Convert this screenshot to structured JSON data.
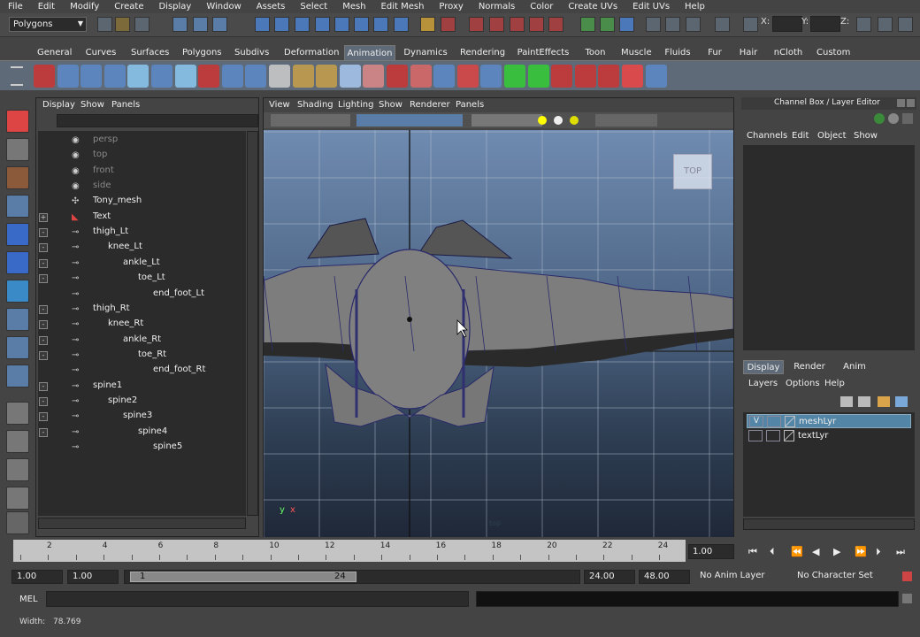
{
  "menubar": [
    "File",
    "Edit",
    "Modify",
    "Create",
    "Display",
    "Window",
    "Assets",
    "Select",
    "Mesh",
    "Edit Mesh",
    "Proxy",
    "Normals",
    "Color",
    "Create UVs",
    "Edit UVs",
    "Help"
  ],
  "statusline": {
    "mode": "Polygons",
    "x_label": "X:",
    "y_label": "Y:",
    "z_label": "Z:"
  },
  "shelf_tabs": [
    "General",
    "Curves",
    "Surfaces",
    "Polygons",
    "Subdivs",
    "Deformation",
    "Animation",
    "Dynamics",
    "Rendering",
    "PaintEffects",
    "Toon",
    "Muscle",
    "Fluids",
    "Fur",
    "Hair",
    "nCloth",
    "Custom"
  ],
  "active_shelf": "Animation",
  "outliner": {
    "menu": [
      "Display",
      "Show",
      "Panels"
    ],
    "items": [
      {
        "label": "persp",
        "dim": true,
        "icon": "camera-icon",
        "expand": ""
      },
      {
        "label": "top",
        "dim": true,
        "icon": "camera-icon",
        "expand": ""
      },
      {
        "label": "front",
        "dim": true,
        "icon": "camera-icon",
        "expand": ""
      },
      {
        "label": "side",
        "dim": true,
        "icon": "camera-icon",
        "expand": ""
      },
      {
        "label": "Tony_mesh",
        "dim": false,
        "icon": "mesh-icon",
        "expand": ""
      },
      {
        "label": "Text",
        "dim": false,
        "icon": "curve-icon",
        "expand": "+"
      },
      {
        "label": "thigh_Lt",
        "dim": false,
        "icon": "joint-icon",
        "expand": "-"
      },
      {
        "label": "knee_Lt",
        "dim": false,
        "icon": "joint-icon",
        "expand": "-"
      },
      {
        "label": "ankle_Lt",
        "dim": false,
        "icon": "joint-icon",
        "expand": "-"
      },
      {
        "label": "toe_Lt",
        "dim": false,
        "icon": "joint-icon",
        "expand": "-"
      },
      {
        "label": "end_foot_Lt",
        "dim": false,
        "icon": "joint-icon",
        "expand": ""
      },
      {
        "label": "thigh_Rt",
        "dim": false,
        "icon": "joint-icon",
        "expand": "-"
      },
      {
        "label": "knee_Rt",
        "dim": false,
        "icon": "joint-icon",
        "expand": "-"
      },
      {
        "label": "ankle_Rt",
        "dim": false,
        "icon": "joint-icon",
        "expand": "-"
      },
      {
        "label": "toe_Rt",
        "dim": false,
        "icon": "joint-icon",
        "expand": "-"
      },
      {
        "label": "end_foot_Rt",
        "dim": false,
        "icon": "joint-icon",
        "expand": ""
      },
      {
        "label": "spine1",
        "dim": false,
        "icon": "joint-icon",
        "expand": "-"
      },
      {
        "label": "spine2",
        "dim": false,
        "icon": "joint-icon",
        "expand": "-"
      },
      {
        "label": "spine3",
        "dim": false,
        "icon": "joint-icon",
        "expand": "-"
      },
      {
        "label": "spine4",
        "dim": false,
        "icon": "joint-icon",
        "expand": "-"
      },
      {
        "label": "spine5",
        "dim": false,
        "icon": "joint-icon",
        "expand": ""
      }
    ]
  },
  "viewport": {
    "menu": [
      "View",
      "Shading",
      "Lighting",
      "Show",
      "Renderer",
      "Panels"
    ],
    "cube_label": "TOP",
    "camera_label": "top",
    "axis_y": "y",
    "axis_x": "x"
  },
  "channel_box": {
    "title": "Channel Box / Layer Editor",
    "menu": [
      "Channels",
      "Edit",
      "Object",
      "Show"
    ],
    "layer_tabs": [
      "Display",
      "Render",
      "Anim"
    ],
    "active_layer_tab": "Display",
    "layer_menu": [
      "Layers",
      "Options",
      "Help"
    ],
    "layers": [
      {
        "v": "V",
        "name": "meshLyr",
        "selected": true
      },
      {
        "v": "",
        "name": "textLyr",
        "selected": false
      }
    ]
  },
  "timeline": {
    "ticks": [
      "2",
      "4",
      "6",
      "8",
      "10",
      "12",
      "14",
      "16",
      "18",
      "20",
      "22",
      "24"
    ],
    "current_frame": "1.00"
  },
  "range": {
    "start": "1.00",
    "anim_start": "1.00",
    "slider_start": "1",
    "slider_end": "24",
    "end": "24.00",
    "anim_end": "48.00",
    "anim_layer": "No Anim Layer",
    "char_set": "No Character Set"
  },
  "mel": {
    "label": "MEL"
  },
  "helpline": {
    "label": "Width:",
    "value": "78.769"
  }
}
